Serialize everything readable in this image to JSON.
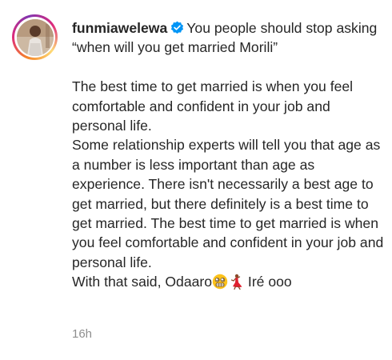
{
  "post": {
    "username": "funmiawelewa",
    "verified_icon": "verified-badge-icon",
    "intro": "You people should stop asking “when will you get married Morili”",
    "paragraph_1": "The best time to get married is when you feel comfortable and confident in your job and personal life.",
    "paragraph_2": "Some relationship experts will tell you that age as a number is less important than age as experience. There isn't necessarily a best age to get married, but there definitely is a best time to get married. The best time to get married is when you feel comfortable and confident in your job and personal life.",
    "closing_start": "With that said, Odaaro",
    "closing_end": " Iré ooo",
    "emojis": [
      "grimacing-dizzy-face-emoji",
      "dancing-woman-emoji"
    ],
    "timestamp": "16h",
    "colors": {
      "text": "#262626",
      "muted": "#8e8e8e",
      "verified": "#0095f6"
    }
  }
}
